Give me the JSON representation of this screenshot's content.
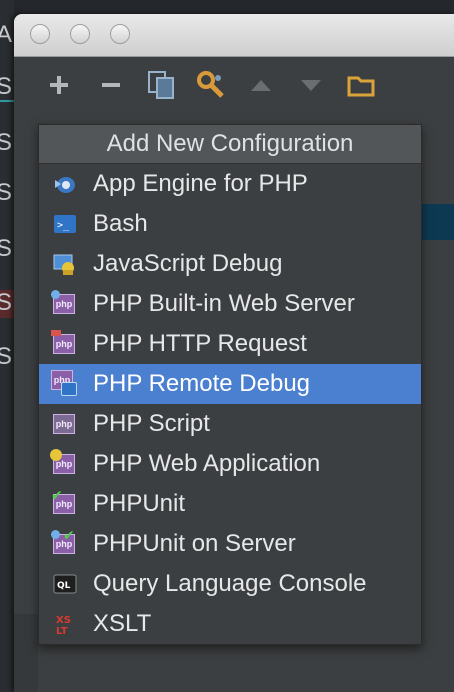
{
  "colors": {
    "window_bg": "#3c3f41",
    "popup_header_bg": "#525659",
    "selection": "#4b7fcf",
    "text": "#e6e7e8",
    "php_purple": "#8a5fa8"
  },
  "background_fragments": [
    "A",
    "S",
    "S",
    "S",
    "S",
    "S",
    "S"
  ],
  "toolbar": {
    "buttons": [
      {
        "name": "add",
        "icon": "plus-icon"
      },
      {
        "name": "remove",
        "icon": "minus-icon"
      },
      {
        "name": "copy",
        "icon": "copy-icon"
      },
      {
        "name": "edit-defaults",
        "icon": "wrench-icon"
      },
      {
        "name": "move-up",
        "icon": "arrow-up-icon"
      },
      {
        "name": "move-down",
        "icon": "arrow-down-icon"
      },
      {
        "name": "folder",
        "icon": "folder-icon"
      }
    ]
  },
  "popup": {
    "title": "Add New Configuration",
    "items": [
      {
        "label": "App Engine for PHP",
        "icon": "app-engine-icon"
      },
      {
        "label": "Bash",
        "icon": "terminal-icon"
      },
      {
        "label": "JavaScript Debug",
        "icon": "javascript-debug-icon"
      },
      {
        "label": "PHP Built-in Web Server",
        "icon": "php-server-icon"
      },
      {
        "label": "PHP HTTP Request",
        "icon": "php-http-icon"
      },
      {
        "label": "PHP Remote Debug",
        "icon": "php-remote-debug-icon",
        "selected": true
      },
      {
        "label": "PHP Script",
        "icon": "php-script-icon"
      },
      {
        "label": "PHP Web Application",
        "icon": "php-web-app-icon"
      },
      {
        "label": "PHPUnit",
        "icon": "phpunit-icon"
      },
      {
        "label": "PHPUnit on Server",
        "icon": "phpunit-server-icon"
      },
      {
        "label": "Query Language Console",
        "icon": "query-language-icon"
      },
      {
        "label": "XSLT",
        "icon": "xslt-icon"
      }
    ]
  }
}
